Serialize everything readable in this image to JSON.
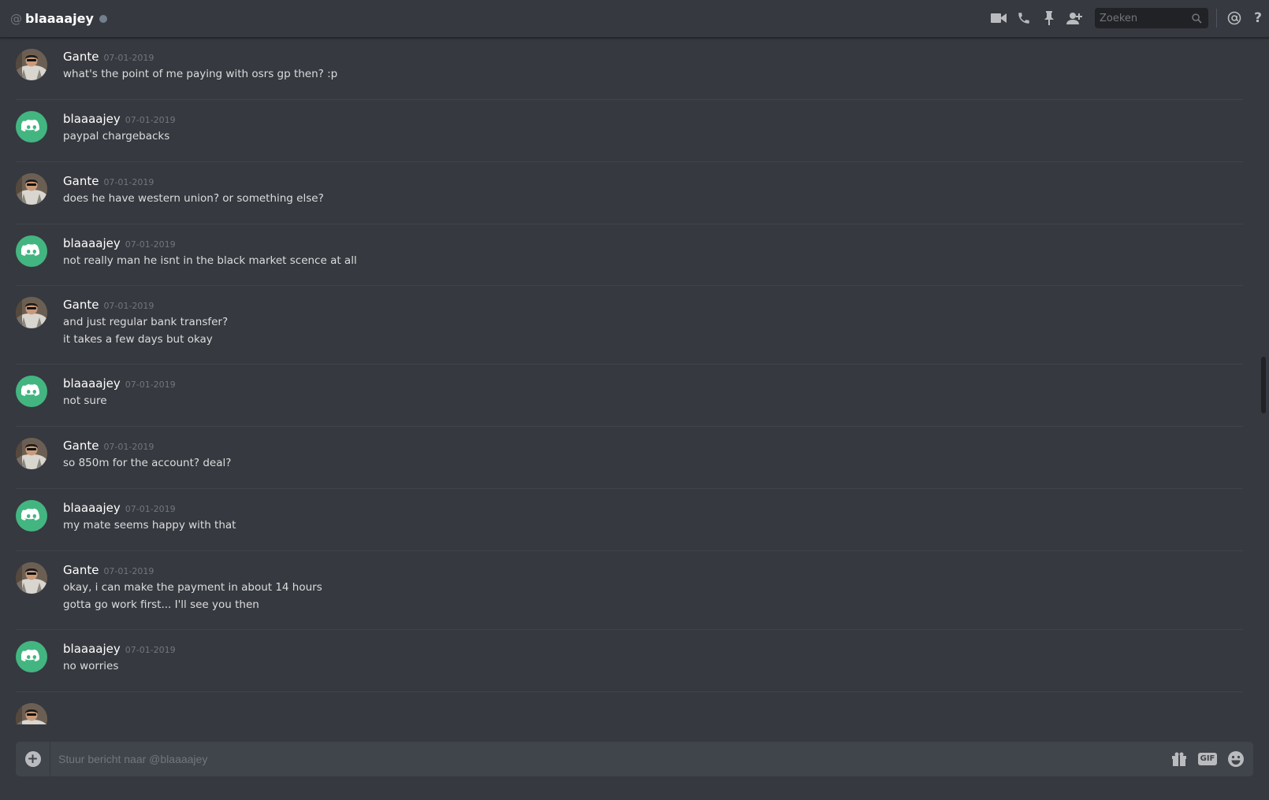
{
  "header": {
    "at_symbol": "@",
    "title": "blaaaajey",
    "search_placeholder": "Zoeken",
    "mentions_symbol": "@",
    "help_symbol": "?"
  },
  "messages": [
    {
      "author": "Gante",
      "avatar": "photo",
      "timestamp": "07-01-2019",
      "lines": [
        "what's the point of me paying with osrs gp then? :p"
      ]
    },
    {
      "author": "blaaaajey",
      "avatar": "discord",
      "timestamp": "07-01-2019",
      "lines": [
        "paypal chargebacks"
      ]
    },
    {
      "author": "Gante",
      "avatar": "photo",
      "timestamp": "07-01-2019",
      "lines": [
        "does he have western union? or something else?"
      ]
    },
    {
      "author": "blaaaajey",
      "avatar": "discord",
      "timestamp": "07-01-2019",
      "lines": [
        "not really man he isnt in the black market scence at all"
      ]
    },
    {
      "author": "Gante",
      "avatar": "photo",
      "timestamp": "07-01-2019",
      "lines": [
        "and just regular bank transfer?",
        "it takes a few days but okay"
      ]
    },
    {
      "author": "blaaaajey",
      "avatar": "discord",
      "timestamp": "07-01-2019",
      "lines": [
        "not sure"
      ]
    },
    {
      "author": "Gante",
      "avatar": "photo",
      "timestamp": "07-01-2019",
      "lines": [
        "so 850m for the account? deal?"
      ]
    },
    {
      "author": "blaaaajey",
      "avatar": "discord",
      "timestamp": "07-01-2019",
      "lines": [
        "my mate seems happy with that"
      ]
    },
    {
      "author": "Gante",
      "avatar": "photo",
      "timestamp": "07-01-2019",
      "lines": [
        "okay, i can make the payment in about 14 hours",
        "gotta go work first... I'll see you then"
      ]
    },
    {
      "author": "blaaaajey",
      "avatar": "discord",
      "timestamp": "07-01-2019",
      "lines": [
        "no worries"
      ]
    }
  ],
  "composer": {
    "placeholder": "Stuur bericht naar @blaaaajey",
    "gif_label": "GIF"
  },
  "colors": {
    "background": "#36393f",
    "discord_green": "#43b581",
    "status_offline": "#747f8d"
  }
}
